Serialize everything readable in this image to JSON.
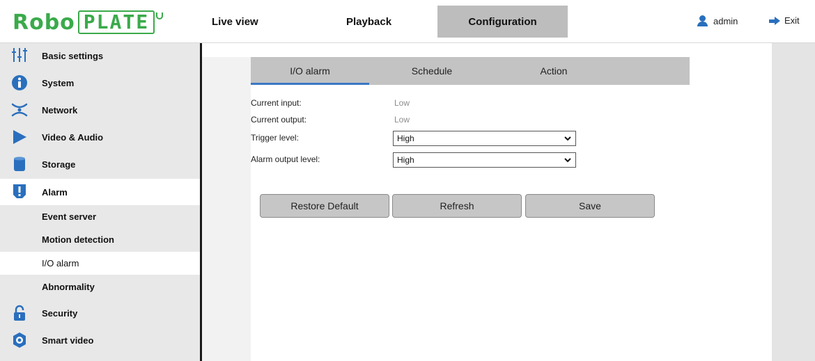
{
  "header": {
    "logo": {
      "text_robo": "Robo",
      "text_plate": "PLATE"
    },
    "nav": {
      "live_view": "Live view",
      "playback": "Playback",
      "configuration": "Configuration"
    },
    "user": {
      "name": "admin",
      "icon": "user-icon"
    },
    "exit": {
      "label": "Exit",
      "icon": "arrow-right-icon"
    }
  },
  "sidebar": {
    "items": [
      {
        "label": "Basic settings",
        "icon": "sliders-icon"
      },
      {
        "label": "System",
        "icon": "info-icon"
      },
      {
        "label": "Network",
        "icon": "network-icon"
      },
      {
        "label": "Video & Audio",
        "icon": "play-icon"
      },
      {
        "label": "Storage",
        "icon": "database-icon"
      },
      {
        "label": "Alarm",
        "icon": "exclamation-icon"
      },
      {
        "label": "Security",
        "icon": "lock-icon"
      },
      {
        "label": "Smart video",
        "icon": "smart-video-icon"
      }
    ],
    "alarm_subitems": [
      {
        "label": "Event server"
      },
      {
        "label": "Motion detection"
      },
      {
        "label": "I/O alarm"
      },
      {
        "label": "Abnormality"
      }
    ],
    "active_item": "Alarm",
    "selected_subitem": "I/O alarm"
  },
  "tabs": [
    {
      "label": "I/O alarm"
    },
    {
      "label": "Schedule"
    },
    {
      "label": "Action"
    }
  ],
  "active_tab": "I/O alarm",
  "form": {
    "current_input": {
      "label": "Current input:",
      "value": "Low"
    },
    "current_output": {
      "label": "Current output:",
      "value": "Low"
    },
    "trigger_level": {
      "label": "Trigger level:",
      "value": "High"
    },
    "alarm_output_level": {
      "label": "Alarm output level:",
      "value": "High"
    }
  },
  "buttons": {
    "restore_default": "Restore Default",
    "refresh": "Refresh",
    "save": "Save"
  },
  "colors": {
    "brand_green": "#3aaa4a",
    "accent_blue": "#2a6fbd",
    "tab_underline": "#3b78c4",
    "config_tab_bg": "#bdbdbd",
    "sidebar_bg": "#e8e8e8"
  }
}
